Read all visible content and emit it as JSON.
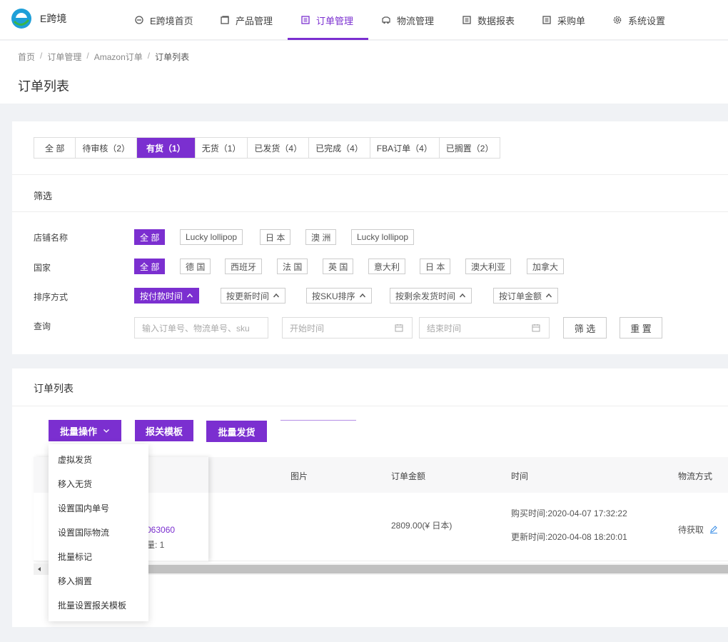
{
  "app": {
    "logo_text": "E跨境",
    "colors": {
      "accent": "#7b2fd0",
      "logo_blue": "#1e9fd8",
      "logo_green": "#39b54a"
    }
  },
  "nav": {
    "items": [
      {
        "label": "E跨境首页",
        "icon": "home-icon"
      },
      {
        "label": "产品管理",
        "icon": "box-icon"
      },
      {
        "label": "订单管理",
        "icon": "order-list-icon",
        "active": true
      },
      {
        "label": "物流管理",
        "icon": "truck-icon"
      },
      {
        "label": "数据报表",
        "icon": "report-icon"
      },
      {
        "label": "采购单",
        "icon": "purchase-icon"
      },
      {
        "label": "系统设置",
        "icon": "gear-icon"
      }
    ]
  },
  "breadcrumb": [
    "首页",
    "订单管理",
    "Amazon订单",
    "订单列表"
  ],
  "page_title": "订单列表",
  "tabs": [
    {
      "label": "全 部"
    },
    {
      "label": "待审核（2）"
    },
    {
      "label": "有货（1）",
      "active": true
    },
    {
      "label": "无货（1）"
    },
    {
      "label": "已发货（4）"
    },
    {
      "label": "已完成（4）"
    },
    {
      "label": "FBA订单（4）"
    },
    {
      "label": "已搁置（2）"
    }
  ],
  "filter": {
    "title": "筛选",
    "store_label": "店铺名称",
    "stores": [
      "全 部",
      "Lucky lollipop",
      "日 本",
      "澳 洲",
      "Lucky lollipop"
    ],
    "country_label": "国家",
    "countries": [
      "全 部",
      "德 国",
      "西班牙",
      "法 国",
      "英 国",
      "意大利",
      "日 本",
      "澳大利亚",
      "加拿大"
    ],
    "sort_label": "排序方式",
    "sorts": [
      "按付款时间",
      "按更新时间",
      "按SKU排序",
      "按剩余发货时间",
      "按订单金额"
    ],
    "query_label": "查询",
    "query_placeholder": "输入订单号、物流单号、sku",
    "start_placeholder": "开始时间",
    "end_placeholder": "结束时间",
    "filter_button": "筛 选",
    "reset_button": "重 置"
  },
  "list": {
    "title": "订单列表",
    "batch_ops": "批量操作",
    "customs_template": "报关模板",
    "batch_ship": "批量发货",
    "columns": {
      "image": "图片",
      "amount": "订单金额",
      "time": "时间",
      "shipping": "物流方式"
    },
    "row": {
      "order_no_partial": "063060",
      "qty_partial": "量: 1",
      "amount": "2809.00(¥ 日本)",
      "purchase_time": "购买时间:2020-04-07 17:32:22",
      "update_time": "更新时间:2020-04-08 18:20:01",
      "shipping": "待获取"
    }
  },
  "dropdown": [
    "虚拟发货",
    "移入无货",
    "设置国内单号",
    "设置国际物流",
    "批量标记",
    "移入搁置",
    "批量设置报关模板"
  ]
}
